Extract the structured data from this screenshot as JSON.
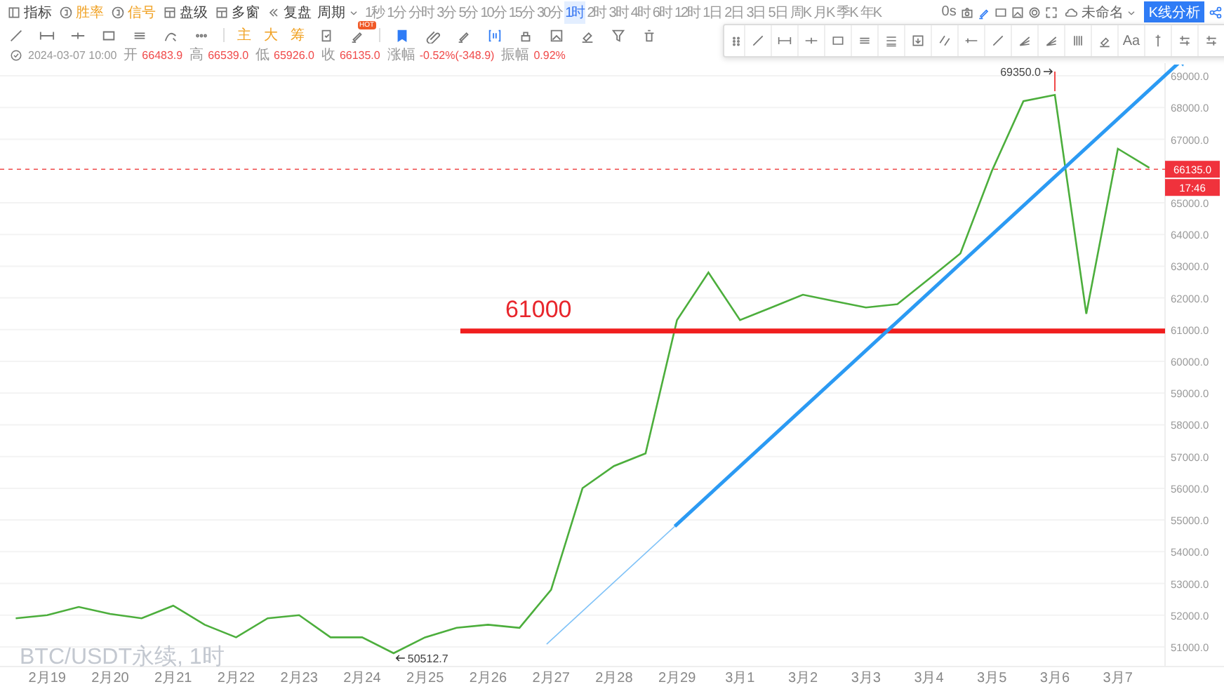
{
  "toolbar": {
    "menu": [
      {
        "kind": "plain",
        "label": "指标"
      },
      {
        "kind": "feature",
        "label": "胜率"
      },
      {
        "kind": "feature",
        "label": "信号"
      },
      {
        "kind": "plain",
        "label": "盘级"
      },
      {
        "kind": "plain",
        "label": "多窗"
      },
      {
        "kind": "plain",
        "label": "复盘"
      },
      {
        "kind": "dropdown",
        "label": "周期"
      }
    ],
    "periods": [
      {
        "label": "1秒",
        "selected": false
      },
      {
        "label": "1分",
        "selected": false
      },
      {
        "label": "分时",
        "selected": false
      },
      {
        "label": "3分",
        "selected": false
      },
      {
        "label": "5分",
        "selected": false
      },
      {
        "label": "10分",
        "selected": false
      },
      {
        "label": "15分",
        "selected": false
      },
      {
        "label": "30分",
        "selected": false
      },
      {
        "label": "1时",
        "selected": true
      },
      {
        "label": "2时",
        "selected": false
      },
      {
        "label": "3时",
        "selected": false
      },
      {
        "label": "4时",
        "selected": false
      },
      {
        "label": "6时",
        "selected": false
      },
      {
        "label": "12时",
        "selected": false
      },
      {
        "label": "1日",
        "selected": false
      },
      {
        "label": "2日",
        "selected": false
      },
      {
        "label": "3日",
        "selected": false
      },
      {
        "label": "5日",
        "selected": false
      },
      {
        "label": "周K",
        "selected": false
      },
      {
        "label": "月K",
        "selected": false
      },
      {
        "label": "季K",
        "selected": false
      },
      {
        "label": "年K",
        "selected": false
      }
    ],
    "countdown": "0s",
    "layout_name": "未命名",
    "analysis_button": "K线分析"
  },
  "drawing_bar": {
    "shortcuts": [
      "主",
      "大",
      "筹"
    ],
    "badge": "HOT"
  },
  "floating_toolbar": {
    "text_tool": "Aa"
  },
  "info_line": {
    "time": "2024-03-07 10:00",
    "fields": [
      {
        "label": "开",
        "value": "66483.9"
      },
      {
        "label": "高",
        "value": "66539.0"
      },
      {
        "label": "低",
        "value": "65926.0"
      },
      {
        "label": "收",
        "value": "66135.0"
      },
      {
        "label": "涨幅",
        "value": "-0.52%(-348.9)"
      },
      {
        "label": "振幅",
        "value": "0.92%"
      }
    ]
  },
  "chart": {
    "last_price": {
      "label": "66135.0",
      "countdown": "17:46"
    },
    "level_line": {
      "label": "61000"
    },
    "chart_data": {
      "type": "line",
      "grid": true,
      "categories": [
        null,
        "2月19",
        null,
        "2月20",
        null,
        "2月21",
        null,
        "2月22",
        null,
        "2月23",
        null,
        "2月24",
        null,
        "2月25",
        null,
        "2月26",
        null,
        "2月27",
        null,
        "2月28",
        null,
        "2月29",
        null,
        "3月1",
        null,
        "3月2",
        null,
        "3月3",
        null,
        "3月4",
        null,
        "3月5",
        null,
        "3月6",
        null,
        "3月7",
        null
      ],
      "series": [
        {
          "name": "BTC/USDT永续, 1时",
          "color": "#4cae3c",
          "values": [
            51900,
            52000,
            52260,
            52040,
            51900,
            52300,
            51700,
            51300,
            51900,
            52000,
            51300,
            51300,
            50800,
            51300,
            51600,
            51700,
            51600,
            52800,
            56000,
            56700,
            57100,
            61300,
            62800,
            61300,
            61700,
            62100,
            61900,
            61700,
            61800,
            62600,
            63400,
            66000,
            68200,
            68400,
            61500,
            66700,
            66100
          ]
        }
      ],
      "ylim": [
        50380,
        69400
      ],
      "yticks": [
        {
          "value": 51000,
          "label": "51000.0"
        },
        {
          "value": 52000,
          "label": "52000.0"
        },
        {
          "value": 53000,
          "label": "53000.0"
        },
        {
          "value": 54000,
          "label": "54000.0"
        },
        {
          "value": 55000,
          "label": "55000.0"
        },
        {
          "value": 56000,
          "label": "56000.0"
        },
        {
          "value": 57000,
          "label": "57000.0"
        },
        {
          "value": 58000,
          "label": "58000.0"
        },
        {
          "value": 59000,
          "label": "59000.0"
        },
        {
          "value": 60000,
          "label": "60000.0"
        },
        {
          "value": 61000,
          "label": "61000.0"
        },
        {
          "value": 62000,
          "label": "62000.0"
        },
        {
          "value": 63000,
          "label": "63000.0"
        },
        {
          "value": 64000,
          "label": "64000.0"
        },
        {
          "value": 65000,
          "label": "65000.0"
        },
        {
          "value": 67000,
          "label": "67000.0"
        },
        {
          "value": 68000,
          "label": "68000.0"
        },
        {
          "value": 69000,
          "label": "69000.0"
        }
      ],
      "annotations": [
        "69350.0",
        "50512.7"
      ]
    }
  }
}
